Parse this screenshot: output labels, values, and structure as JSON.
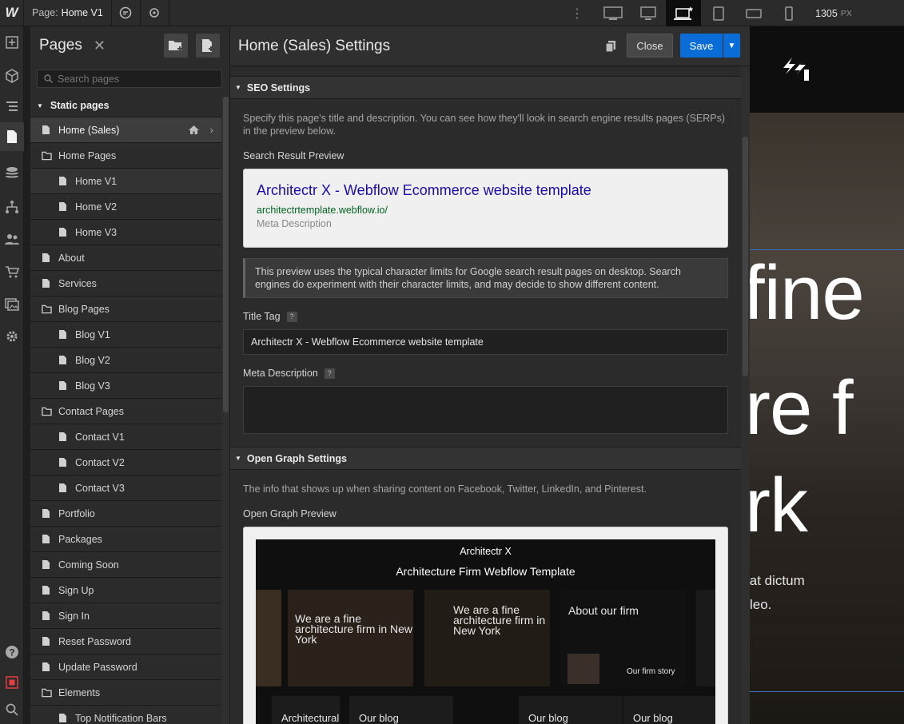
{
  "topbar": {
    "logo": "W",
    "page_prefix": "Page:",
    "page_name": "Home V1",
    "width_value": "1305",
    "width_unit": "PX",
    "icons": [
      "comments-icon",
      "preview-eye-icon",
      "more-vertical-icon",
      "desktop-large-icon",
      "desktop-icon",
      "laptop-base-icon",
      "tablet-icon",
      "mobile-landscape-icon",
      "mobile-portrait-icon"
    ]
  },
  "rail": {
    "icons": [
      "add-icon",
      "navigator-cube-icon",
      "layers-icon",
      "pages-icon",
      "cms-database-icon",
      "logic-icon",
      "users-icon",
      "ecommerce-cart-icon",
      "assets-icon",
      "settings-gear-icon",
      "help-icon",
      "record-icon",
      "search-icon"
    ],
    "active": "pages-icon"
  },
  "pages_panel": {
    "title": "Pages",
    "close": "✕",
    "search_placeholder": "Search pages",
    "static_label": "Static pages",
    "rows": [
      {
        "label": "Home (Sales)",
        "type": "page",
        "level": 0,
        "active": true
      },
      {
        "label": "Home Pages",
        "type": "folder",
        "level": 0
      },
      {
        "label": "Home V1",
        "type": "page",
        "level": 1,
        "selected": true
      },
      {
        "label": "Home V2",
        "type": "page",
        "level": 1
      },
      {
        "label": "Home V3",
        "type": "page",
        "level": 1
      },
      {
        "label": "About",
        "type": "page",
        "level": 0
      },
      {
        "label": "Services",
        "type": "page",
        "level": 0
      },
      {
        "label": "Blog Pages",
        "type": "folder",
        "level": 0
      },
      {
        "label": "Blog V1",
        "type": "page",
        "level": 1
      },
      {
        "label": "Blog V2",
        "type": "page",
        "level": 1
      },
      {
        "label": "Blog V3",
        "type": "page",
        "level": 1
      },
      {
        "label": "Contact Pages",
        "type": "folder",
        "level": 0
      },
      {
        "label": "Contact V1",
        "type": "page",
        "level": 1
      },
      {
        "label": "Contact V2",
        "type": "page",
        "level": 1
      },
      {
        "label": "Contact V3",
        "type": "page",
        "level": 1
      },
      {
        "label": "Portfolio",
        "type": "page",
        "level": 0
      },
      {
        "label": "Packages",
        "type": "page",
        "level": 0
      },
      {
        "label": "Coming Soon",
        "type": "page",
        "level": 0
      },
      {
        "label": "Sign Up",
        "type": "page",
        "level": 0
      },
      {
        "label": "Sign In",
        "type": "page",
        "level": 0
      },
      {
        "label": "Reset Password",
        "type": "page",
        "level": 0
      },
      {
        "label": "Update Password",
        "type": "page",
        "level": 0
      },
      {
        "label": "Elements",
        "type": "folder",
        "level": 0
      },
      {
        "label": "Top Notification Bars",
        "type": "page",
        "level": 1
      }
    ]
  },
  "settings": {
    "title": "Home (Sales) Settings",
    "close_label": "Close",
    "save_label": "Save",
    "seo": {
      "heading": "SEO Settings",
      "help": "Specify this page's title and description. You can see how they'll look in search engine results pages (SERPs) in the preview below.",
      "preview_label": "Search Result Preview",
      "preview_title": "Architectr X - Webflow Ecommerce website template",
      "preview_url": "architectrtemplate.webflow.io/",
      "preview_desc": "Meta Description",
      "note": "This preview uses the typical character limits for Google search result pages on desktop. Search engines do experiment with their character limits, and may decide to show different content.",
      "title_tag_label": "Title Tag",
      "title_tag_value": "Architectr X - Webflow Ecommerce website template",
      "meta_desc_label": "Meta Description",
      "meta_desc_value": ""
    },
    "og": {
      "heading": "Open Graph Settings",
      "help": "The info that shows up when sharing content on Facebook, Twitter, LinkedIn, and Pinterest.",
      "preview_label": "Open Graph Preview",
      "image_brand": "Architectr X",
      "image_subtitle": "Architecture Firm Webflow Template",
      "cards": [
        "We are a fine architecture firm in New York",
        "We are a fine architecture firm in New York",
        "About our firm"
      ],
      "card_story": "Our firm story",
      "card_bottom": [
        "Architectural",
        "Our blog",
        "Our blog",
        "Our blog"
      ]
    }
  },
  "canvas": {
    "big_lines": [
      "fine",
      "re f",
      "rk"
    ],
    "small_lines": [
      "iat dictum",
      "leo."
    ]
  }
}
